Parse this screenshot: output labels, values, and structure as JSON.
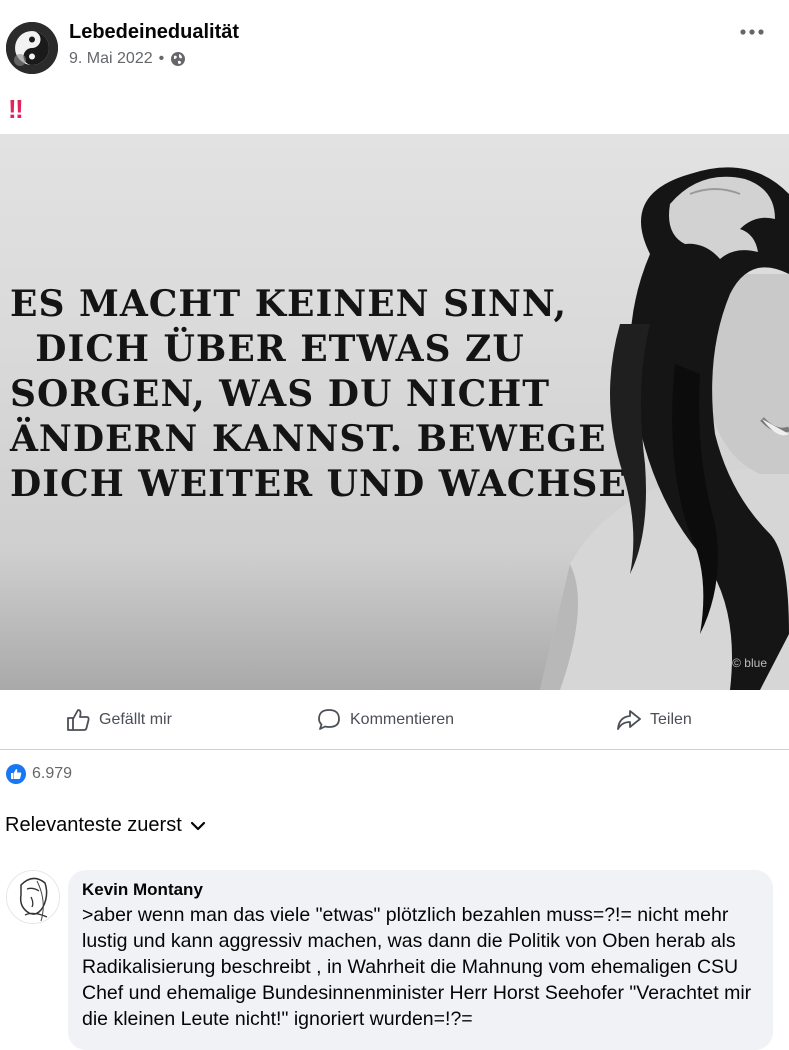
{
  "post": {
    "page_name": "Lebedeinedualität",
    "date": "9. Mai 2022",
    "separator": "•",
    "emoji": "‼",
    "image": {
      "quote_lines": [
        "Es macht keinen Sinn,",
        "dich über etwas zu",
        "sorgen, was du nicht",
        "ändern kannst. Bewege",
        "dich weiter und wachse."
      ],
      "watermark": "© blue"
    }
  },
  "actions": {
    "like_label": "Gefällt mir",
    "comment_label": "Kommentieren",
    "share_label": "Teilen"
  },
  "reactions": {
    "count": "6.979"
  },
  "comments_sort": {
    "label": "Relevanteste zuerst"
  },
  "comment": {
    "author": "Kevin Montany",
    "text": ">aber wenn man das viele \"etwas\"  plötzlich bezahlen muss=?!= nicht mehr lustig und kann aggressiv machen, was dann die Politik von Oben herab als Radikalisierung beschreibt , in Wahrheit die Mahnung vom ehemaligen CSU Chef und ehemalige Bundesinnenminister Herr Horst Seehofer \"Verachtet mir die kleinen Leute nicht!\"  ignoriert wurden=!?="
  },
  "icons": {
    "more": "more-horizontal-icon",
    "audience": "globe-icon",
    "like": "thumbs-up-icon",
    "comment": "speech-bubble-icon",
    "share": "share-arrow-icon",
    "sort": "chevron-down-icon"
  },
  "colors": {
    "accent": "#1877f2",
    "emoji_red": "#e0245e",
    "secondary_text": "#65676b",
    "bubble": "#f0f2f5"
  }
}
